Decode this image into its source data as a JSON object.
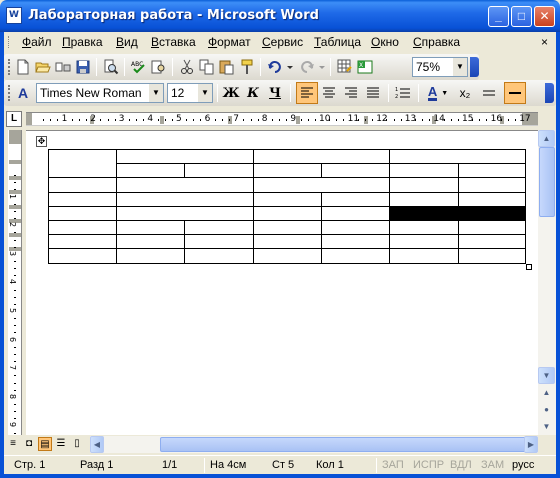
{
  "window": {
    "title": "Лабораторная работа - Microsoft Word",
    "app_icon": "W",
    "minimize_glyph": "_",
    "maximize_glyph": "□",
    "close_glyph": "✕"
  },
  "menu": {
    "items": [
      "Файл",
      "Правка",
      "Вид",
      "Вставка",
      "Формат",
      "Сервис",
      "Таблица",
      "Окно",
      "Справка"
    ],
    "close_glyph": "×"
  },
  "standard_toolbar": {
    "zoom_value": "75%",
    "icons": [
      "new-document-icon",
      "open-icon",
      "permission-icon",
      "save-icon",
      "print-preview-icon",
      "spelling-icon",
      "research-icon",
      "cut-icon",
      "copy-icon",
      "paste-icon",
      "format-painter-icon",
      "undo-icon",
      "redo-icon",
      "insert-table-icon",
      "insert-excel-icon"
    ]
  },
  "formatting_toolbar": {
    "style_label": "A",
    "font_name": "Times New Roman",
    "font_size": "12",
    "bold_label": "Ж",
    "italic_label": "К",
    "underline_label": "Ч",
    "font_color_label": "A",
    "subscript_label": "x₂"
  },
  "ruler": {
    "corner_label": "L",
    "labels": [
      "1",
      "2",
      "3",
      "4",
      "5",
      "6",
      "7",
      "8",
      "9",
      "10",
      "11",
      "12",
      "13",
      "14",
      "15",
      "16",
      "17"
    ],
    "vertical_labels": [
      "1",
      "2",
      "3",
      "4",
      "5",
      "6",
      "7",
      "8",
      "9",
      "10"
    ]
  },
  "document": {
    "table_move_glyph": "✥"
  },
  "statusbar": {
    "page": "Стр.  1",
    "section": "Разд  1",
    "pages": "1/1",
    "at": "На 4см",
    "line": "Ст  5",
    "column": "Кол  1",
    "rec": "ЗАП",
    "trk": "ИСПР",
    "ext": "ВДЛ",
    "ovr": "ЗАМ",
    "language": "русс"
  }
}
